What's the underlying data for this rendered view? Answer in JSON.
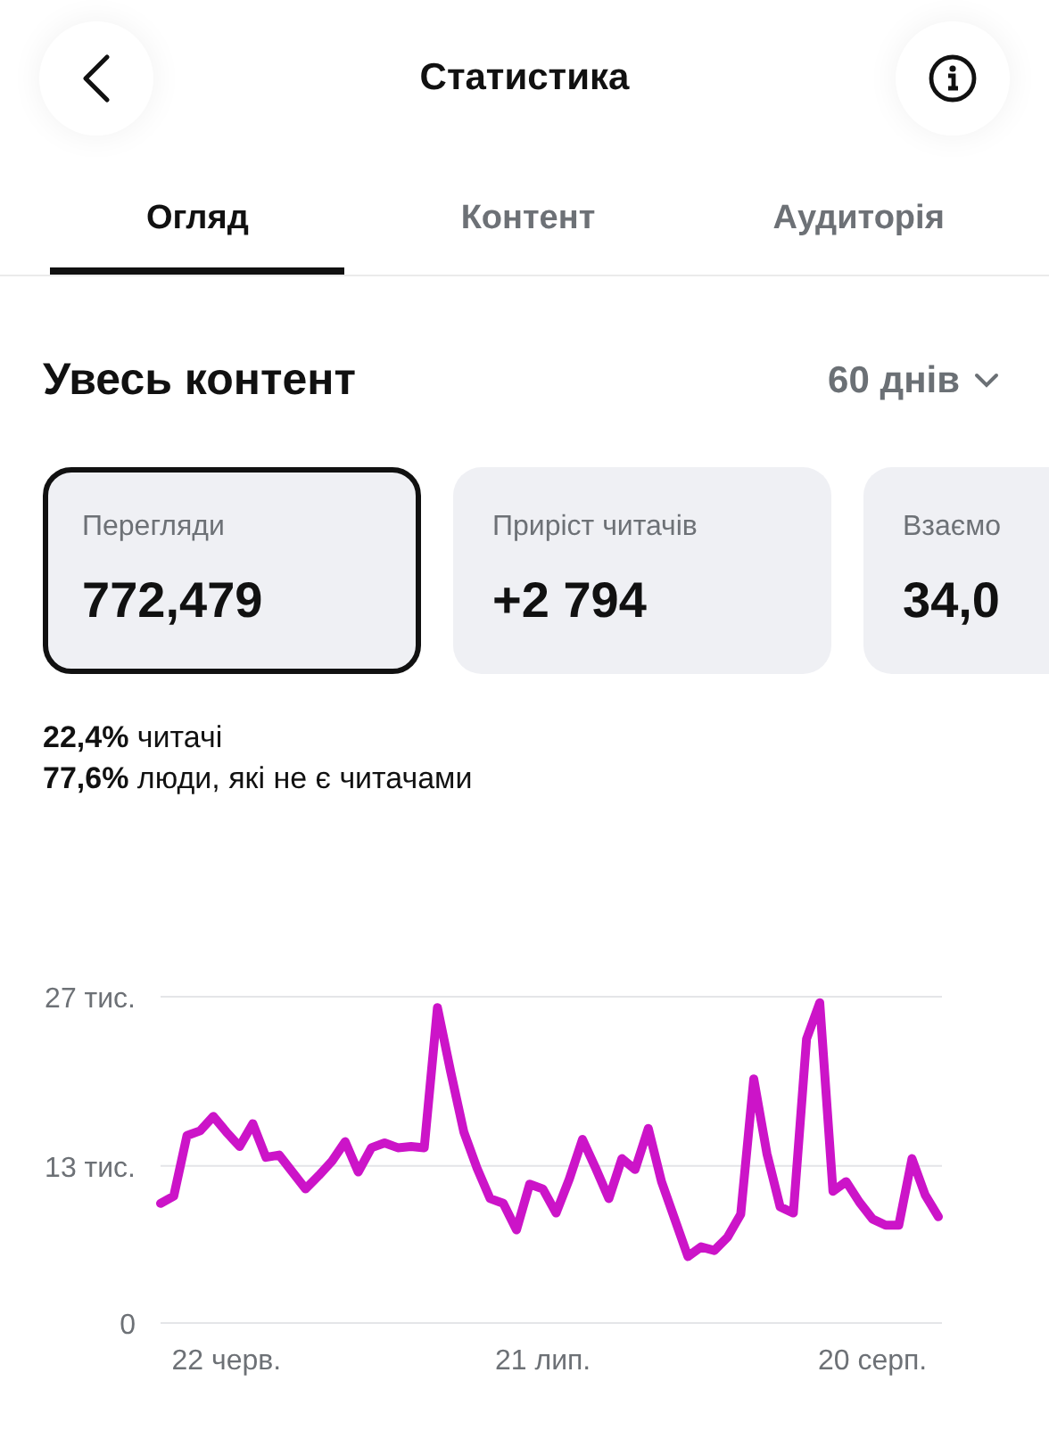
{
  "header": {
    "title": "Статистика"
  },
  "tabs": [
    {
      "label": "Огляд",
      "selected": true
    },
    {
      "label": "Контент",
      "selected": false
    },
    {
      "label": "Аудиторія",
      "selected": false
    }
  ],
  "section": {
    "title": "Увесь контент",
    "period": "60 днів"
  },
  "cards": [
    {
      "label": "Перегляди",
      "value": "772,479",
      "selected": true
    },
    {
      "label": "Приріст читачів",
      "value": "+2 794",
      "selected": false
    },
    {
      "label": "Взаємо",
      "value": "34,0",
      "selected": false
    }
  ],
  "breakdown": [
    "**22,4%** читачі",
    "**77,6%** люди, які не є читачами"
  ],
  "chart_data": {
    "type": "line",
    "categories": [
      null,
      null,
      null,
      null,
      null,
      "22 черв.",
      null,
      null,
      null,
      null,
      null,
      null,
      null,
      null,
      null,
      null,
      null,
      null,
      null,
      null,
      null,
      null,
      null,
      null,
      null,
      null,
      null,
      null,
      null,
      "21 лип.",
      null,
      null,
      null,
      null,
      null,
      null,
      null,
      null,
      null,
      null,
      null,
      null,
      null,
      null,
      null,
      null,
      null,
      null,
      null,
      null,
      null,
      null,
      null,
      null,
      "20 серп.",
      null,
      null,
      null,
      null,
      null
    ],
    "series": [
      {
        "color": "#cc14c8",
        "values": [
          9.9,
          10.5,
          15.5,
          15.9,
          17.1,
          15.8,
          14.6,
          16.5,
          13.7,
          13.9,
          12.5,
          11.1,
          12.2,
          13.4,
          15.0,
          12.5,
          14.5,
          14.9,
          14.5,
          14.6,
          14.5,
          26.1,
          20.8,
          15.8,
          12.8,
          10.3,
          9.9,
          7.7,
          11.5,
          11.1,
          9.1,
          11.9,
          15.2,
          12.8,
          10.3,
          13.6,
          12.7,
          16.1,
          11.7,
          8.6,
          5.5,
          6.3,
          6.0,
          7.1,
          9.0,
          20.2,
          14.0,
          9.6,
          9.1,
          23.5,
          26.5,
          10.9,
          11.7,
          10.0,
          8.6,
          8.1,
          8.1,
          13.6,
          10.6,
          8.8
        ]
      }
    ],
    "ylim": [
      0,
      27
    ],
    "yticks": [
      {
        "value": 0,
        "label": "0"
      },
      {
        "value": 13,
        "label": "13 тис."
      },
      {
        "value": 27,
        "label": "27 тис."
      }
    ]
  }
}
